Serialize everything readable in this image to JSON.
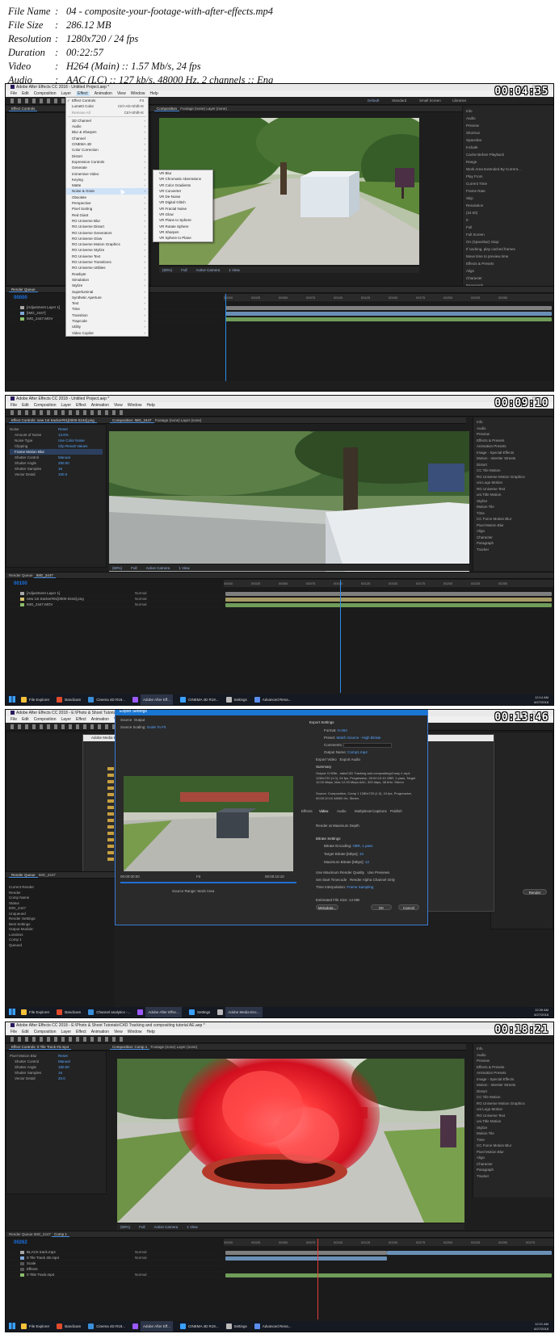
{
  "info": {
    "rows": [
      {
        "label": "File Name",
        "value": "04 - composite-your-footage-with-after-effects.mp4"
      },
      {
        "label": "File Size",
        "value": "286.12 MB"
      },
      {
        "label": "Resolution",
        "value": "1280x720 / 24 fps"
      },
      {
        "label": "Duration",
        "value": "00:22:57"
      },
      {
        "label": "Video",
        "value": "H264 (Main) :: 1.57 Mb/s, 24 fps"
      },
      {
        "label": "Audio",
        "value": "AAC (LC) :: 127 kb/s, 48000 Hz, 2 channels :: Eng"
      }
    ],
    "separator": ":"
  },
  "frames": [
    {
      "stamp": "00:04:35",
      "title": "Adobe After Effects CC 2018 - Untitled Project.aep *",
      "menu": [
        "File",
        "Edit",
        "Composition",
        "Layer",
        "Effect",
        "Animation",
        "View",
        "Window",
        "Help"
      ],
      "tabs": [
        "Effect Controls",
        "Composition",
        "Footage (none)",
        "Layer (none)"
      ],
      "workspace": [
        "Default",
        "Standard",
        "Small Screen",
        "Libraries"
      ],
      "timecode": "00000",
      "viewer_bar": [
        "(50%)",
        "Full",
        "Active Camera",
        "1 View"
      ],
      "effect_menu": {
        "items": [
          {
            "label": "Effect Controls",
            "shortcut": "F3",
            "checked": true
          },
          {
            "label": "Lumetri Color",
            "shortcut": "Ctrl+Alt+Shift+E"
          },
          {
            "label": "Remove All",
            "shortcut": "Ctrl+Shift+E",
            "disabled": true
          },
          {
            "sep": true
          },
          {
            "label": "3D Channel"
          },
          {
            "label": "Audio"
          },
          {
            "label": "Blur & Sharpen"
          },
          {
            "label": "Channel"
          },
          {
            "label": "CINEMA 4D"
          },
          {
            "label": "Color Correction"
          },
          {
            "label": "Distort"
          },
          {
            "label": "Expression Controls"
          },
          {
            "label": "Generate"
          },
          {
            "label": "Immersive Video"
          },
          {
            "label": "Keying"
          },
          {
            "label": "Matte"
          },
          {
            "label": "Noise & Grain",
            "highlight": true
          },
          {
            "label": "Obsolete"
          },
          {
            "label": "Perspective"
          },
          {
            "label": "Pixel Sorting"
          },
          {
            "label": "Red Giant"
          },
          {
            "label": "RG Universe Blur"
          },
          {
            "label": "RG Universe Distort"
          },
          {
            "label": "RG Universe Generators"
          },
          {
            "label": "RG Universe Glow"
          },
          {
            "label": "RG Universe Motion Graphics"
          },
          {
            "label": "RG Universe Stylize"
          },
          {
            "label": "RG Universe Text"
          },
          {
            "label": "RG Universe Transitions"
          },
          {
            "label": "RG Universe Utilities"
          },
          {
            "label": "Rowbyte"
          },
          {
            "label": "Simulation"
          },
          {
            "label": "Stylize"
          },
          {
            "label": "Superluminal"
          },
          {
            "label": "Synthetic Aperture"
          },
          {
            "label": "Text"
          },
          {
            "label": "Time"
          },
          {
            "label": "Transition"
          },
          {
            "label": "Trapcode"
          },
          {
            "label": "Utility"
          },
          {
            "label": "Video Copilot"
          }
        ]
      },
      "submenu": [
        "VR Blur",
        "VR Chromatic Aberrations",
        "VR Color Gradients",
        "VR Converter",
        "VR De-Noise",
        "VR Digital Glitch",
        "VR Fractal Noise",
        "VR Glow",
        "VR Plane to Sphere",
        "VR Rotate Sphere",
        "VR Sharpen",
        "VR Sphere to Plane"
      ],
      "right_panel": [
        "Info",
        "Audio",
        "Preview",
        "Shortcut",
        "Spacebar",
        "Include",
        "Cache Before Playback",
        "Range",
        "Work Area Extended By Current...",
        "Play From",
        "Current Time",
        "Frame Rate",
        "Skip",
        "Resolution",
        "(24.00)",
        "0",
        "Full",
        "Full Screen",
        "On (Spacebar) Stop:",
        "If caching, play cached frames",
        "Move time to preview time",
        "Effects & Presets",
        "Align",
        "Character",
        "Paragraph",
        "Tracker"
      ],
      "layers": [
        {
          "name": "[Adjustment Layer 1]",
          "mode": "Normal",
          "color": "#a7a7a7"
        },
        {
          "name": "[IMG_2447]",
          "mode": "Normal",
          "color": "#7ea7d8"
        },
        {
          "name": "IMG_2447.MOV",
          "mode": "Normal",
          "color": "#8bbf6a"
        }
      ],
      "ruler": [
        "00000",
        "00025",
        "00050",
        "00075",
        "00100",
        "00125",
        "00150",
        "00175",
        "00200",
        "00225",
        "00250"
      ]
    },
    {
      "stamp": "00:09:10",
      "title": "Adobe After Effects CC 2018 - Untitled Project.aep *",
      "menu": [
        "File",
        "Edit",
        "Composition",
        "Layer",
        "Effect",
        "Animation",
        "View",
        "Window",
        "Help"
      ],
      "tabs": [
        "Effect Controls: new 1st tracker#01[0000-0244].png",
        "Composition: IMG_2447",
        "Footage (none)",
        "Layer (none)"
      ],
      "effect_controls": [
        {
          "label": "Noise",
          "value": "Reset"
        },
        {
          "label": "Amount of Noise",
          "value": "13.6%"
        },
        {
          "label": "Noise Type",
          "value": "Use Color Noise"
        },
        {
          "label": "Clipping",
          "value": "Clip Result Values"
        },
        {
          "label": "Frame Motion Blur",
          "value": "",
          "selected": true
        },
        {
          "label": "Shutter Control",
          "value": "Manual"
        },
        {
          "label": "Shutter Angle",
          "value": "290.00"
        },
        {
          "label": "Shutter Samples",
          "value": "16"
        },
        {
          "label": "Vector Detail",
          "value": "100.0"
        }
      ],
      "timecode": "00100",
      "viewer_bar": [
        "(50%)",
        "Full",
        "Active Camera",
        "1 View"
      ],
      "right_panel": [
        "Info",
        "Audio",
        "Preview",
        "Effects & Presets",
        "Animation Presets",
        "Image - Special Effects",
        "Motion - Intertier Streets",
        "Distort",
        "CC Tile Motion",
        "RG Universe Motion Graphics",
        "uni.Logo Motion",
        "RG Universe Text",
        "uni.Title Motion",
        "Stylize",
        "Motion Tile",
        "Time",
        "CC Force Motion Blur",
        "Pixel Motion Blur",
        "Align",
        "Character",
        "Paragraph",
        "Tracker"
      ],
      "layers": [
        {
          "name": "[Adjustment Layer 1]",
          "mode": "Normal",
          "color": "#a7a7a7"
        },
        {
          "name": "new 1st tracker#01[0000-0244].png",
          "mode": "Normal",
          "color": "#d9c26c"
        },
        {
          "name": "IMG_2447.MOV",
          "mode": "Normal",
          "color": "#8bbf6a"
        }
      ],
      "ruler": [
        "00000",
        "00025",
        "00050",
        "00075",
        "00100",
        "00125",
        "00150",
        "00175",
        "00200",
        "00225",
        "00250"
      ],
      "taskbar": [
        "File Explorer",
        "Bandicam",
        "Cinema 4D R19...",
        "Adobe After Eff...",
        "CINEMA 4D R19...",
        "Settings",
        "Advanced Rena..."
      ],
      "clock": [
        "12:14 AM",
        "6/27/2018"
      ]
    },
    {
      "stamp": "00:13:46",
      "title": "Adobe After Effects CC 2018 - E:\\Photo & Shoot Tutorials\\C4D Tracking and compositing tutorial AE.aep *",
      "menu": [
        "File",
        "Edit",
        "Composition",
        "Layer",
        "Effect",
        "Animation",
        "View",
        "Window",
        "Help"
      ],
      "dialog": {
        "title": "Export Settings",
        "tabs": [
          "Source",
          "Output"
        ],
        "source_scaling_label": "Source Scaling:",
        "source_scaling": "Scale To Fit",
        "export_settings_label": "Export Settings",
        "format_label": "Format:",
        "format": "H.264",
        "preset_label": "Preset:",
        "preset": "Match Source - High bitrate",
        "comments_label": "Comments:",
        "output_name_label": "Output Name:",
        "output_name": "Comp1.mp4",
        "export_video": "Export Video",
        "export_audio": "Export Audio",
        "summary_label": "Summary",
        "summary_output": "Output: D:\\Effe...rials\\C4D Tracking and compositing\\Comp 1.mp4  1280x720 (1.0), 24 fps, Progressive, 00:00:10:10  VBR, 1 pass, Target 10.00 Mbps, Max 12.00 Mbps  AAC, 320 kbps, 48 kHz, Stereo",
        "summary_source": "Source: Composition, Comp 1  1280x720 (1.0), 24 fps, Progressive, 00:00:10:10  48000 Hz, Stereo",
        "settings_tabs": [
          "Effects",
          "Video",
          "Audio",
          "Multiplexer",
          "Captions",
          "Publish"
        ],
        "render_max_depth": "Render at Maximum Depth",
        "bitrate_label": "Bitrate Settings",
        "bitrate_encoding_label": "Bitrate Encoding:",
        "bitrate_encoding": "VBR, 1 pass",
        "target_bitrate_label": "Target Bitrate [Mbps]:",
        "target_bitrate": "10",
        "max_bitrate_label": "Maximum Bitrate [Mbps]:",
        "max_bitrate": "12",
        "use_max_render": "Use Maximum Render Quality",
        "use_previews": "Use Previews",
        "set_start_tc": "Set Start Timecode",
        "render_alpha": "Render Alpha Channel Only",
        "time_interp_label": "Time Interpolation:",
        "time_interp": "Frame Sampling",
        "est_size_label": "Estimated File Size:",
        "est_size": "14 MB",
        "metadata_btn": "Metadata...",
        "ok_btn": "OK",
        "cancel_btn": "Cancel",
        "time_start": "00:00:00:00",
        "time_end": "00:00:10:10",
        "fit": "Fit",
        "source_range_label": "Source Range:",
        "source_range": "Work Area"
      },
      "media_encoder_title": "Adobe Media Encoder",
      "render_queue_tabs": [
        "Render Queue",
        "IMG_2447"
      ],
      "render_label": "Render",
      "render_items": [
        "Current Render",
        "Render",
        "Comp Name",
        "Status",
        "IMG_2447",
        "Unqueued",
        "Render Settings:",
        "Best Settings",
        "Output Module:",
        "Lossless",
        "Comp 1",
        "Queued"
      ],
      "taskbar": [
        "File Explorer",
        "Bandicam",
        "Channel analytics -...",
        "Adobe After Effec...",
        "Settings",
        "Adobe Media Enc..."
      ],
      "clock": [
        "12:39 AM",
        "6/27/2018"
      ]
    },
    {
      "stamp": "00:18:21",
      "title": "Adobe After Effects CC 2018 - E:\\Photo & Shoot Tutorials\\C4D Tracking and compositing tutorial AE.aep *",
      "menu": [
        "File",
        "Edit",
        "Composition",
        "Layer",
        "Effect",
        "Animation",
        "View",
        "Window",
        "Help"
      ],
      "tabs": [
        "Effect Controls: 0 Tile Track #3.mp4",
        "Composition: Comp 1",
        "Footage (none)",
        "Layer (none)"
      ],
      "effect_controls": [
        {
          "label": "Pixel Motion Blur",
          "value": "Reset"
        },
        {
          "label": "Shutter Control",
          "value": "Manual"
        },
        {
          "label": "Shutter Angle",
          "value": "180.00"
        },
        {
          "label": "Shutter Samples",
          "value": "16"
        },
        {
          "label": "Vector Detail",
          "value": "20.0"
        }
      ],
      "timecode": "00262",
      "viewer_bar": [
        "(50%)",
        "Full",
        "Active Camera",
        "1 View"
      ],
      "right_panel": [
        "Info",
        "Audio",
        "Preview",
        "Effects & Presets",
        "Animation Presets",
        "Image - Special Effects",
        "Motion - Intertier Streets",
        "Distort",
        "CC Tile Motion",
        "RG Universe Motion Graphics",
        "uni.Logo Motion",
        "RG Universe Text",
        "uni.Title Motion",
        "Stylize",
        "Motion Tile",
        "Time",
        "CC Force Motion Blur",
        "Pixel Motion Blur",
        "Align",
        "Character",
        "Paragraph",
        "Tracker"
      ],
      "timeline_tabs": [
        "Render Queue",
        "IMG_2447",
        "Comp 1"
      ],
      "layers": [
        {
          "name": "BLACK track.mp4",
          "mode": "Normal",
          "color": "#a7a7a7"
        },
        {
          "name": "0 Tile Track 4D.mp4",
          "mode": "Normal",
          "color": "#7ea7d8"
        },
        {
          "name": "Scale",
          "mode": "",
          "color": "#555555"
        },
        {
          "name": "Effects",
          "mode": "",
          "color": "#555555"
        },
        {
          "name": "0 Title Track.mp4",
          "mode": "Normal",
          "color": "#8bbf6a"
        }
      ],
      "ruler": [
        "00000",
        "00025",
        "00050",
        "00075",
        "00100",
        "00125",
        "00150",
        "00175",
        "00200",
        "00225",
        "00250",
        "00275"
      ],
      "taskbar": [
        "File Explorer",
        "Bandicam",
        "Cinema 4D R19...",
        "Adobe After Eff...",
        "CINEMA 4D R19...",
        "Settings",
        "Advanced Rena..."
      ],
      "clock": [
        "12:21 AM",
        "6/27/2018"
      ]
    }
  ]
}
